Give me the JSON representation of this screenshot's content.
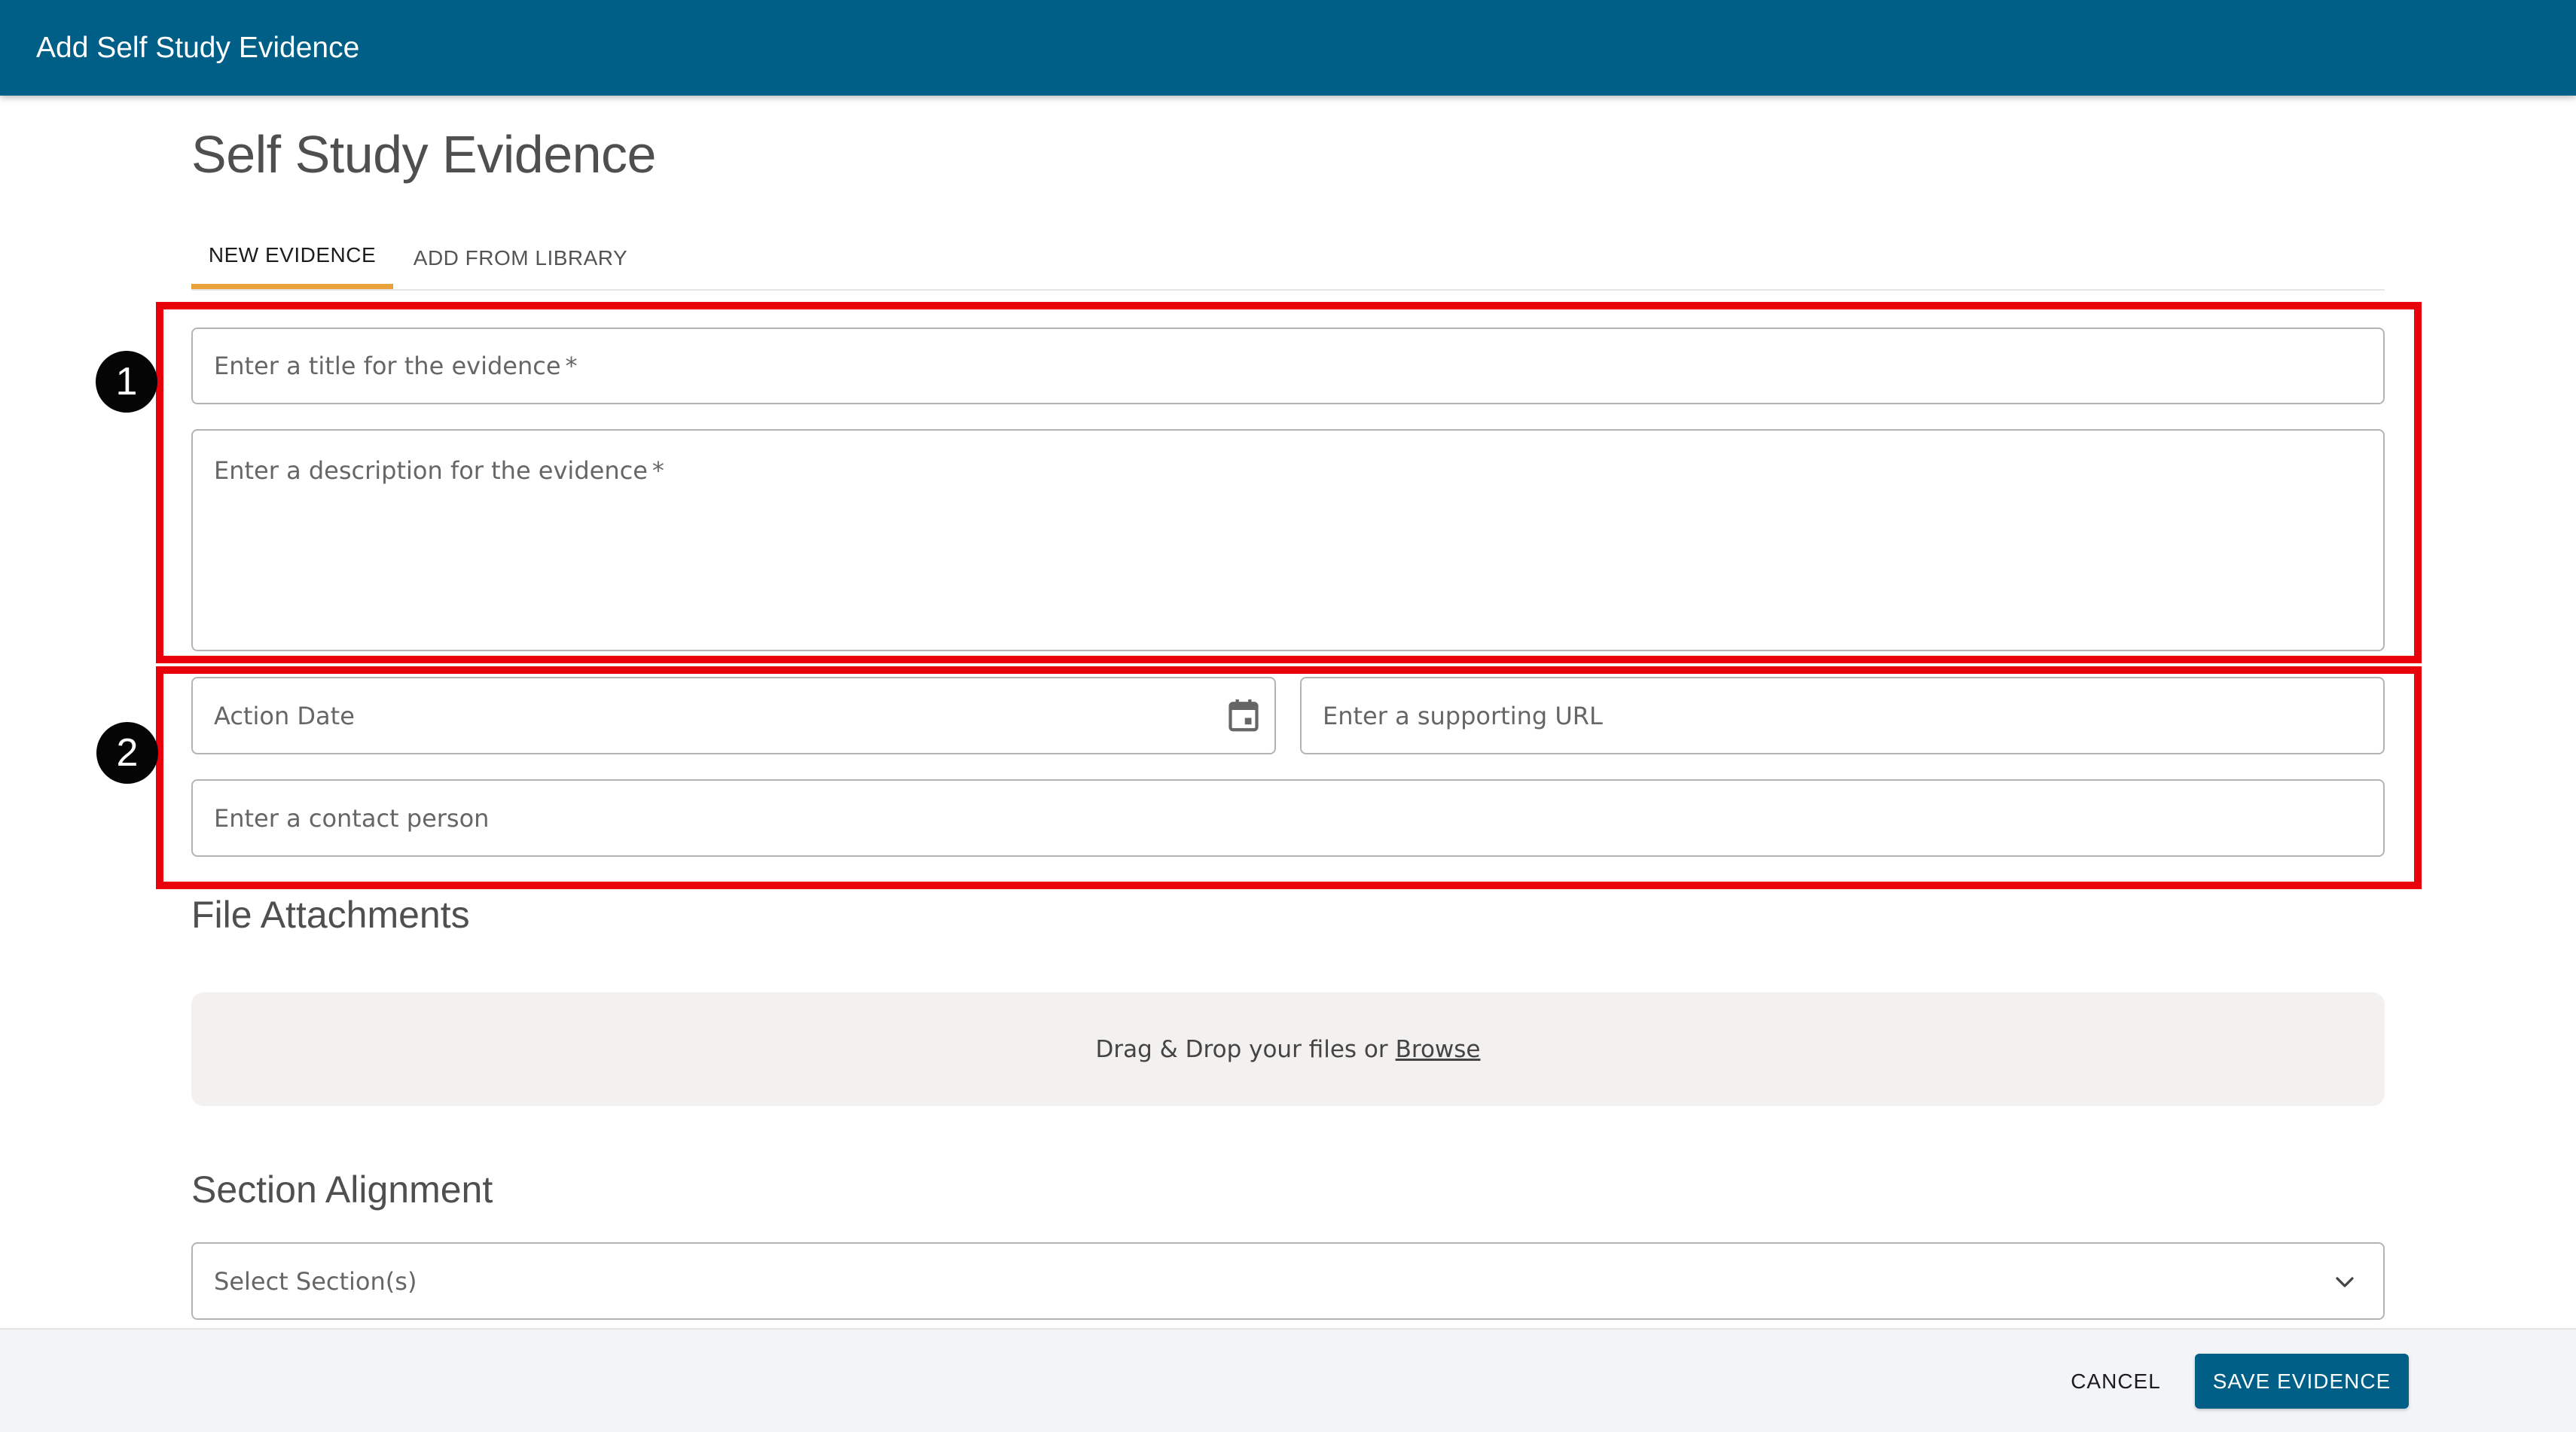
{
  "header": {
    "title": "Add Self Study Evidence"
  },
  "page": {
    "title": "Self Study Evidence"
  },
  "tabs": [
    {
      "label": "NEW EVIDENCE",
      "active": true
    },
    {
      "label": "ADD FROM LIBRARY",
      "active": false
    }
  ],
  "annotations": [
    "1",
    "2"
  ],
  "form": {
    "title_placeholder": "Enter a title for the evidence",
    "description_placeholder": "Enter a description for the evidence",
    "required_marker": "*",
    "action_date_placeholder": "Action Date",
    "url_placeholder": "Enter a supporting URL",
    "contact_placeholder": "Enter a contact person"
  },
  "attachments": {
    "heading": "File Attachments",
    "dropzone_text": "Drag & Drop your files or",
    "browse_label": "Browse"
  },
  "alignment": {
    "heading": "Section Alignment",
    "select_placeholder": "Select Section(s)"
  },
  "footer": {
    "cancel_label": "CANCEL",
    "save_label": "SAVE EVIDENCE"
  },
  "colors": {
    "brand": "#005f87",
    "tab_indicator": "#e9a13b",
    "annotation": "#e8000b"
  },
  "icons": [
    "calendar-icon",
    "chevron-down-icon"
  ]
}
